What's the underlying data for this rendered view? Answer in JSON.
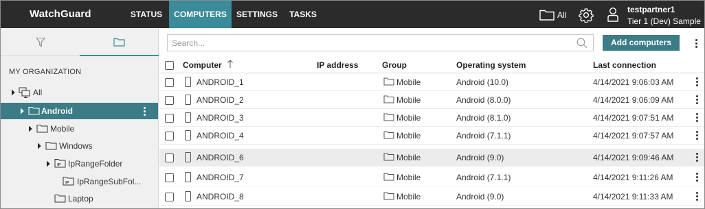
{
  "app": {
    "logo": "WatchGuard"
  },
  "nav": {
    "tabs": [
      {
        "label": "STATUS",
        "active": false
      },
      {
        "label": "COMPUTERS",
        "active": true
      },
      {
        "label": "SETTINGS",
        "active": false
      },
      {
        "label": "TASKS",
        "active": false
      }
    ]
  },
  "topbar": {
    "folder_scope_label": "All",
    "user_name": "testpartner1",
    "user_tier": "Tier 1 (Dev) Sample"
  },
  "left_panel": {
    "tabs": [
      {
        "icon": "filter-icon",
        "active": false
      },
      {
        "icon": "folder-icon",
        "active": true
      }
    ],
    "org_title": "MY ORGANIZATION",
    "tree": [
      {
        "label": "All",
        "icon": "computers-group-icon",
        "expanded": true,
        "selected": false
      },
      {
        "label": "Android",
        "icon": "folder-icon",
        "expanded": true,
        "selected": true
      },
      {
        "label": "Mobile",
        "icon": "folder-icon",
        "expanded": true,
        "selected": false
      },
      {
        "label": "Windows",
        "icon": "folder-icon",
        "expanded": true,
        "selected": false
      },
      {
        "label": "IpRangeFolder",
        "icon": "ip-folder-icon",
        "expanded": true,
        "selected": false
      },
      {
        "label": "IpRangeSubFol...",
        "icon": "ip-folder-icon",
        "expanded": false,
        "selected": false
      },
      {
        "label": "Laptop",
        "icon": "folder-icon",
        "expanded": false,
        "selected": false
      }
    ]
  },
  "main": {
    "search": {
      "placeholder": "Search...",
      "value": ""
    },
    "add_button_label": "Add computers",
    "columns": [
      "Computer",
      "IP address",
      "Group",
      "Operating system",
      "Last connection"
    ],
    "sort": {
      "column": "Computer",
      "direction": "ascending"
    },
    "rows": [
      {
        "computer": "ANDROID_1",
        "ip": "",
        "group": "Mobile",
        "os": "Android (10.0)",
        "last_connection": "4/14/2021 9:06:03 AM",
        "hover": false
      },
      {
        "computer": "ANDROID_2",
        "ip": "",
        "group": "Mobile",
        "os": "Android (8.0.0)",
        "last_connection": "4/14/2021 9:06:09 AM",
        "hover": false
      },
      {
        "computer": "ANDROID_3",
        "ip": "",
        "group": "Mobile",
        "os": "Android (8.1.0)",
        "last_connection": "4/14/2021 9:07:51 AM",
        "hover": false
      },
      {
        "computer": "ANDROID_4",
        "ip": "",
        "group": "Mobile",
        "os": "Android (7.1.1)",
        "last_connection": "4/14/2021 9:07:57 AM",
        "hover": false
      },
      {
        "computer": "ANDROID_6",
        "ip": "",
        "group": "Mobile",
        "os": "Android (9.0)",
        "last_connection": "4/14/2021 9:09:46 AM",
        "hover": true
      },
      {
        "computer": "ANDROID_7",
        "ip": "",
        "group": "Mobile",
        "os": "Android (7.1.1)",
        "last_connection": "4/14/2021 9:11:26 AM",
        "hover": false
      },
      {
        "computer": "ANDROID_8",
        "ip": "",
        "group": "Mobile",
        "os": "Android (9.0)",
        "last_connection": "4/14/2021 9:11:33 AM",
        "hover": false
      }
    ]
  },
  "colors": {
    "topbar_bg": "#2b2b2b",
    "accent": "#3b8b9a",
    "selected_tree_bg": "#3b7c87",
    "left_panel_bg": "#f0f0f0",
    "row_hover_bg": "#ececec"
  }
}
